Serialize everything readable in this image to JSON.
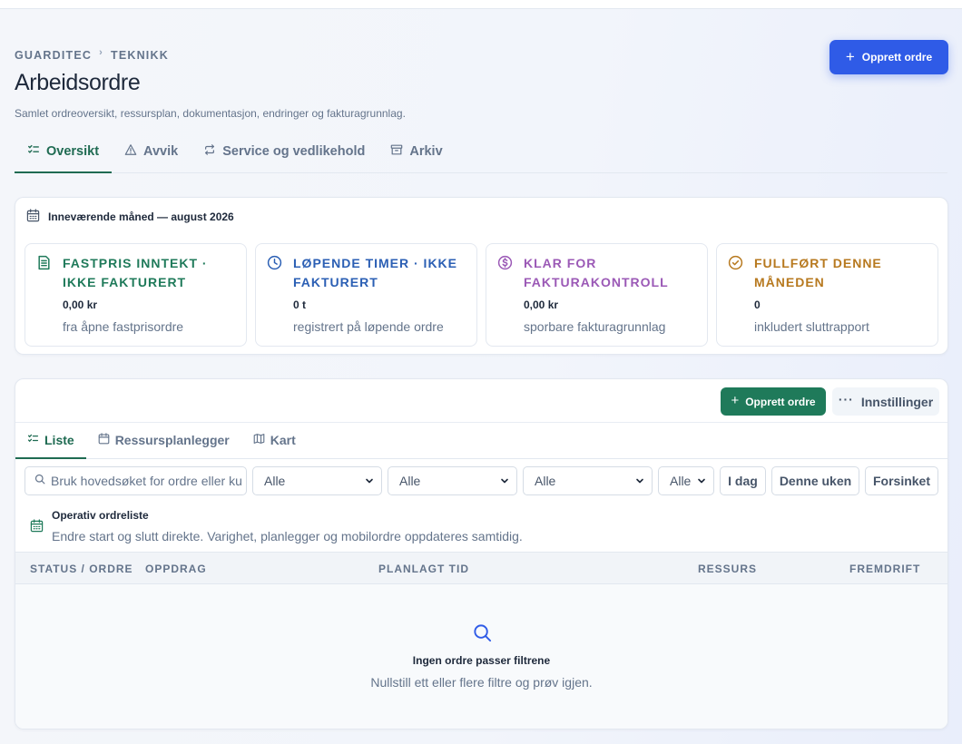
{
  "breadcrumb": {
    "items": [
      "GUARDITEC",
      "TEKNIKK"
    ]
  },
  "header": {
    "title": "Arbeidsordre",
    "subtitle": "Samlet ordreoversikt, ressursplan, dokumentasjon, endringer og fakturagrunnlag.",
    "create_button": "Opprett ordre"
  },
  "tabs": [
    {
      "label": "Oversikt",
      "icon": "checklist-icon",
      "active": true
    },
    {
      "label": "Avvik",
      "icon": "warning-icon",
      "active": false
    },
    {
      "label": "Service og vedlikehold",
      "icon": "repeat-icon",
      "active": false
    },
    {
      "label": "Arkiv",
      "icon": "archive-icon",
      "active": false
    }
  ],
  "month": {
    "heading": "Inneværende måned — august 2026",
    "stats": [
      {
        "title": "FASTPRIS INNTEKT · IKKE FAKTURERT",
        "value": "0,00 kr",
        "desc": "fra åpne fastprisordre",
        "color": "#1f7a5a",
        "icon": "document-icon"
      },
      {
        "title": "LØPENDE TIMER · IKKE FAKTURERT",
        "value": "0 t",
        "desc": "registrert på løpende ordre",
        "color": "#2b5fb4",
        "icon": "clock-icon"
      },
      {
        "title": "KLAR FOR FAKTURAKONTROLL",
        "value": "0,00 kr",
        "desc": "sporbare fakturagrunnlag",
        "color": "#9b59b6",
        "icon": "dollar-icon"
      },
      {
        "title": "FULLFØRT DENNE MÅNEDEN",
        "value": "0",
        "desc": "inkludert sluttrapport",
        "color": "#b7791f",
        "icon": "check-circle-icon"
      }
    ]
  },
  "list": {
    "create_button": "Opprett ordre",
    "settings_button": "Innstillinger",
    "subtabs": [
      {
        "label": "Liste",
        "icon": "checklist-icon",
        "active": true
      },
      {
        "label": "Ressursplanlegger",
        "icon": "calendar-icon",
        "active": false
      },
      {
        "label": "Kart",
        "icon": "map-icon",
        "active": false
      }
    ],
    "search": {
      "placeholder": "Bruk hovedsøket for ordre eller kunder",
      "value": ""
    },
    "selects": [
      "Alle",
      "Alle",
      "Alle",
      "Alle"
    ],
    "quick_filters": [
      "I dag",
      "Denne uken",
      "Forsinket"
    ],
    "section": {
      "title": "Operativ ordreliste",
      "desc": "Endre start og slutt direkte. Varighet, planlegger og mobilordre oppdateres samtidig."
    },
    "columns": [
      "STATUS / ORDRE",
      "OPPDRAG",
      "PLANLAGT TID",
      "RESSURS",
      "FREMDRIFT"
    ],
    "empty": {
      "title": "Ingen ordre passer filtrene",
      "desc": "Nullstill ett eller flere filtre og prøv igjen."
    }
  },
  "colors": {
    "primary": "#2f5be7",
    "accent_green": "#1f7a5a",
    "text": "#1e293b",
    "muted": "#64748b"
  }
}
